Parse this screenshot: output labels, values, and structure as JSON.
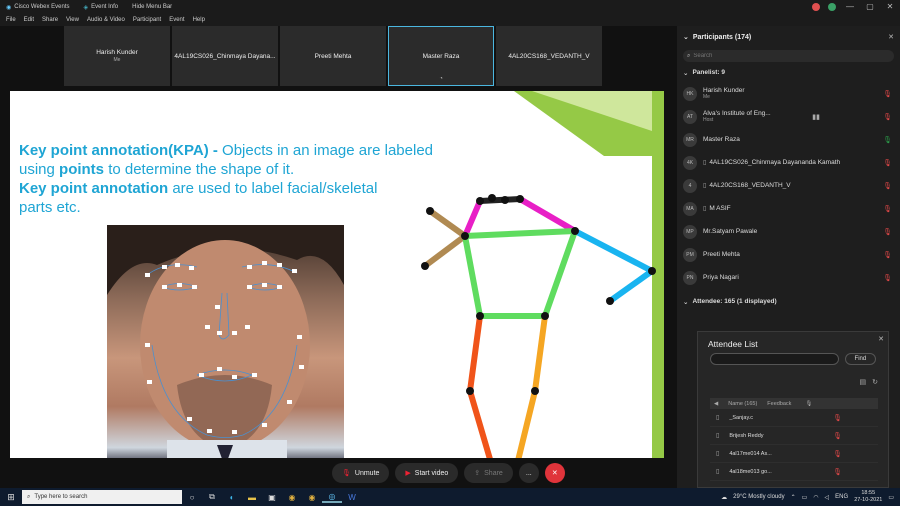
{
  "titlebar": {
    "app_name": "Cisco Webex Events",
    "event_info": "Event Info",
    "hide_menu": "Hide Menu Bar"
  },
  "menu": [
    "File",
    "Edit",
    "Share",
    "View",
    "Audio & Video",
    "Participant",
    "Event",
    "Help"
  ],
  "tiles": [
    {
      "name": "Harish Kunder",
      "sub": "Me",
      "active": false
    },
    {
      "name": "4AL19CS026_Chinmaya Dayana...",
      "sub": "",
      "active": false
    },
    {
      "name": "Preeti Mehta",
      "sub": "",
      "active": false
    },
    {
      "name": "Master Raza",
      "sub": "",
      "active": true
    },
    {
      "name": "4AL20CS168_VEDANTH_V",
      "sub": "",
      "active": false
    }
  ],
  "slide": {
    "line1_bold": "Key point annotation(KPA) - ",
    "line1_rest": "Objects in an image are labeled",
    "line2_pre": "using ",
    "line2_bold": "points",
    "line2_rest": " to determine the shape of it.",
    "line3_bold": "Key point annotation",
    "line3_rest": " are used to label facial/skeletal",
    "line4": "parts etc."
  },
  "controls": {
    "unmute": "Unmute",
    "start_video": "Start video",
    "share": "Share",
    "more": "...",
    "end": "✕"
  },
  "participants": {
    "title": "Participants (174)",
    "search_placeholder": "Search",
    "panelist_label": "Panelist: 9",
    "attendee_label": "Attendee: 165 (1 displayed)",
    "panelists": [
      {
        "initials": "HK",
        "name": "Harish Kunder",
        "role": "Me",
        "device": "",
        "mic": "muted"
      },
      {
        "initials": "AT",
        "name": "Alva's Institute of Eng...",
        "role": "Host",
        "device": "",
        "mic": "muted"
      },
      {
        "initials": "MR",
        "name": "Master Raza",
        "role": "",
        "device": "",
        "mic": "on"
      },
      {
        "initials": "4K",
        "name": "4AL19CS026_Chinmaya Dayananda Kamath",
        "role": "",
        "device": "▯",
        "mic": "muted"
      },
      {
        "initials": "4",
        "name": "4AL20CS168_VEDANTH_V",
        "role": "",
        "device": "▯",
        "mic": "muted"
      },
      {
        "initials": "MA",
        "name": "M ASIF",
        "role": "",
        "device": "▯",
        "mic": "muted"
      },
      {
        "initials": "MP",
        "name": "Mr.Satyam Pawale",
        "role": "",
        "device": "",
        "mic": "muted"
      },
      {
        "initials": "PM",
        "name": "Preeti Mehta",
        "role": "",
        "device": "",
        "mic": "muted"
      },
      {
        "initials": "PN",
        "name": "Priya Nagari",
        "role": "",
        "device": "",
        "mic": "muted"
      }
    ]
  },
  "attendee_list": {
    "title": "Attendee List",
    "find_label": "Find",
    "columns": [
      "Name (165)",
      "Feedback"
    ],
    "rows": [
      {
        "name": "_Sanjay.c"
      },
      {
        "name": "Brijesh Reddy"
      },
      {
        "name": "4al17me014 As..."
      },
      {
        "name": "4al18me013 go..."
      }
    ]
  },
  "taskbar": {
    "search_placeholder": "Type here to search",
    "weather": "29°C  Mostly cloudy",
    "time": "18:55",
    "date": "27-10-2021"
  },
  "colors": {
    "slide_text": "#1fa5d4",
    "accent_green": "#95c946",
    "end_red": "#e0343b"
  }
}
